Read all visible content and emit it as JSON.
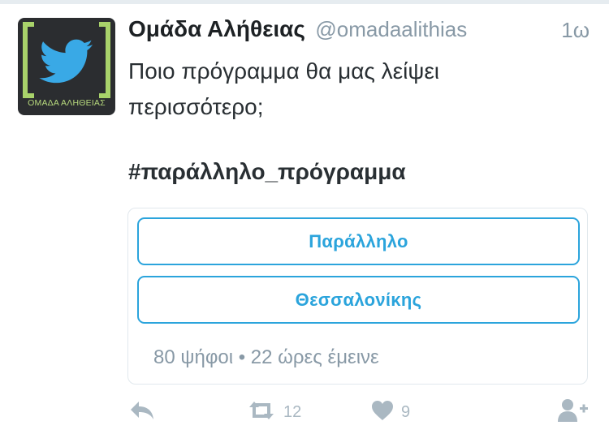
{
  "tweet": {
    "display_name": "Ομάδα Αλήθειας",
    "handle": "@omadaalithias",
    "time": "1ω",
    "text_line1": "Ποιο πρόγραμμα θα μας λείψει",
    "text_line2": "περισσότερο;",
    "hashtag": "#παράλληλο_πρόγραμμα",
    "avatar_caption": "ΟΜΑΔΑ ΑΛΗΘΕΙΑΣ"
  },
  "poll": {
    "options": [
      {
        "label": "Παράλληλο"
      },
      {
        "label": "Θεσσαλονίκης"
      }
    ],
    "footer": "80 ψήφοι • 22 ώρες έμεινε"
  },
  "actions": {
    "reply_icon": "reply-icon",
    "retweet_icon": "retweet-icon",
    "retweet_count": "12",
    "like_icon": "heart-icon",
    "like_count": "9",
    "follow_icon": "follow-user-icon"
  },
  "colors": {
    "accent": "#2ba4dc",
    "muted": "#8899a6",
    "icon": "#aab8c2",
    "avatar_bg": "#2b2d30",
    "avatar_bracket": "#a8d26a",
    "twitter_bird": "#39a9e6"
  }
}
